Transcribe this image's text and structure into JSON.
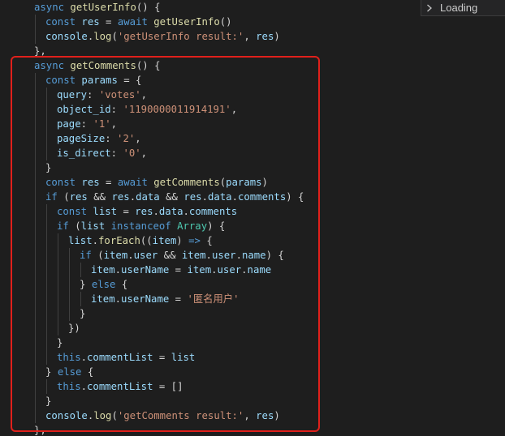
{
  "panel": {
    "label": "Loading",
    "icon": "chevron-right-icon"
  },
  "code_lines": [
    {
      "indent": 1,
      "tokens": [
        [
          "kw",
          "async "
        ],
        [
          "fn",
          "getUserInfo"
        ],
        [
          "pn",
          "() {"
        ]
      ]
    },
    {
      "indent": 2,
      "tokens": [
        [
          "kw",
          "const "
        ],
        [
          "vr",
          "res"
        ],
        [
          "pn",
          " = "
        ],
        [
          "kw",
          "await "
        ],
        [
          "fn",
          "getUserInfo"
        ],
        [
          "pn",
          "()"
        ]
      ]
    },
    {
      "indent": 2,
      "tokens": [
        [
          "vr",
          "console"
        ],
        [
          "pn",
          "."
        ],
        [
          "fn",
          "log"
        ],
        [
          "pn",
          "("
        ],
        [
          "st",
          "'getUserInfo result:'"
        ],
        [
          "pn",
          ", "
        ],
        [
          "vr",
          "res"
        ],
        [
          "pn",
          ")"
        ]
      ]
    },
    {
      "indent": 1,
      "tokens": [
        [
          "pn",
          "},"
        ]
      ]
    },
    {
      "indent": 1,
      "tokens": [
        [
          "kw",
          "async "
        ],
        [
          "fn",
          "getComments"
        ],
        [
          "pn",
          "() {"
        ]
      ]
    },
    {
      "indent": 2,
      "tokens": [
        [
          "kw",
          "const "
        ],
        [
          "vr",
          "params"
        ],
        [
          "pn",
          " = {"
        ]
      ]
    },
    {
      "indent": 3,
      "tokens": [
        [
          "vr",
          "query"
        ],
        [
          "pn",
          ": "
        ],
        [
          "st",
          "'votes'"
        ],
        [
          "pn",
          ","
        ]
      ]
    },
    {
      "indent": 3,
      "tokens": [
        [
          "vr",
          "object_id"
        ],
        [
          "pn",
          ": "
        ],
        [
          "st",
          "'1190000011914191'"
        ],
        [
          "pn",
          ","
        ]
      ]
    },
    {
      "indent": 3,
      "tokens": [
        [
          "vr",
          "page"
        ],
        [
          "pn",
          ": "
        ],
        [
          "st",
          "'1'"
        ],
        [
          "pn",
          ","
        ]
      ]
    },
    {
      "indent": 3,
      "tokens": [
        [
          "vr",
          "pageSize"
        ],
        [
          "pn",
          ": "
        ],
        [
          "st",
          "'2'"
        ],
        [
          "pn",
          ","
        ]
      ]
    },
    {
      "indent": 3,
      "tokens": [
        [
          "vr",
          "is_direct"
        ],
        [
          "pn",
          ": "
        ],
        [
          "st",
          "'0'"
        ],
        [
          "pn",
          ","
        ]
      ]
    },
    {
      "indent": 2,
      "tokens": [
        [
          "pn",
          "}"
        ]
      ]
    },
    {
      "indent": 2,
      "tokens": [
        [
          "kw",
          "const "
        ],
        [
          "vr",
          "res"
        ],
        [
          "pn",
          " = "
        ],
        [
          "kw",
          "await "
        ],
        [
          "fn",
          "getComments"
        ],
        [
          "pn",
          "("
        ],
        [
          "vr",
          "params"
        ],
        [
          "pn",
          ")"
        ]
      ]
    },
    {
      "indent": 2,
      "tokens": [
        [
          "kw",
          "if "
        ],
        [
          "pn",
          "("
        ],
        [
          "vr",
          "res"
        ],
        [
          "pn",
          " && "
        ],
        [
          "vr",
          "res"
        ],
        [
          "pn",
          "."
        ],
        [
          "vr",
          "data"
        ],
        [
          "pn",
          " && "
        ],
        [
          "vr",
          "res"
        ],
        [
          "pn",
          "."
        ],
        [
          "vr",
          "data"
        ],
        [
          "pn",
          "."
        ],
        [
          "vr",
          "comments"
        ],
        [
          "pn",
          ") {"
        ]
      ]
    },
    {
      "indent": 3,
      "tokens": [
        [
          "kw",
          "const "
        ],
        [
          "vr",
          "list"
        ],
        [
          "pn",
          " = "
        ],
        [
          "vr",
          "res"
        ],
        [
          "pn",
          "."
        ],
        [
          "vr",
          "data"
        ],
        [
          "pn",
          "."
        ],
        [
          "vr",
          "comments"
        ]
      ]
    },
    {
      "indent": 3,
      "tokens": [
        [
          "kw",
          "if "
        ],
        [
          "pn",
          "("
        ],
        [
          "vr",
          "list"
        ],
        [
          "pn",
          " "
        ],
        [
          "kw",
          "instanceof "
        ],
        [
          "ty",
          "Array"
        ],
        [
          "pn",
          ") {"
        ]
      ]
    },
    {
      "indent": 4,
      "tokens": [
        [
          "vr",
          "list"
        ],
        [
          "pn",
          "."
        ],
        [
          "fn",
          "forEach"
        ],
        [
          "pn",
          "(("
        ],
        [
          "vr",
          "item"
        ],
        [
          "pn",
          ") "
        ],
        [
          "kw",
          "=>"
        ],
        [
          "pn",
          " {"
        ]
      ]
    },
    {
      "indent": 5,
      "tokens": [
        [
          "kw",
          "if "
        ],
        [
          "pn",
          "("
        ],
        [
          "vr",
          "item"
        ],
        [
          "pn",
          "."
        ],
        [
          "vr",
          "user"
        ],
        [
          "pn",
          " && "
        ],
        [
          "vr",
          "item"
        ],
        [
          "pn",
          "."
        ],
        [
          "vr",
          "user"
        ],
        [
          "pn",
          "."
        ],
        [
          "vr",
          "name"
        ],
        [
          "pn",
          ") {"
        ]
      ]
    },
    {
      "indent": 6,
      "tokens": [
        [
          "vr",
          "item"
        ],
        [
          "pn",
          "."
        ],
        [
          "vr",
          "userName"
        ],
        [
          "pn",
          " = "
        ],
        [
          "vr",
          "item"
        ],
        [
          "pn",
          "."
        ],
        [
          "vr",
          "user"
        ],
        [
          "pn",
          "."
        ],
        [
          "vr",
          "name"
        ]
      ]
    },
    {
      "indent": 5,
      "tokens": [
        [
          "pn",
          "} "
        ],
        [
          "kw",
          "else"
        ],
        [
          "pn",
          " {"
        ]
      ]
    },
    {
      "indent": 6,
      "tokens": [
        [
          "vr",
          "item"
        ],
        [
          "pn",
          "."
        ],
        [
          "vr",
          "userName"
        ],
        [
          "pn",
          " = "
        ],
        [
          "st",
          "'匿名用户'"
        ]
      ]
    },
    {
      "indent": 5,
      "tokens": [
        [
          "pn",
          "}"
        ]
      ]
    },
    {
      "indent": 4,
      "tokens": [
        [
          "pn",
          "})"
        ]
      ]
    },
    {
      "indent": 3,
      "tokens": [
        [
          "pn",
          "}"
        ]
      ]
    },
    {
      "indent": 3,
      "tokens": [
        [
          "kw",
          "this"
        ],
        [
          "pn",
          "."
        ],
        [
          "vr",
          "commentList"
        ],
        [
          "pn",
          " = "
        ],
        [
          "vr",
          "list"
        ]
      ]
    },
    {
      "indent": 2,
      "tokens": [
        [
          "pn",
          "} "
        ],
        [
          "kw",
          "else"
        ],
        [
          "pn",
          " {"
        ]
      ]
    },
    {
      "indent": 3,
      "tokens": [
        [
          "kw",
          "this"
        ],
        [
          "pn",
          "."
        ],
        [
          "vr",
          "commentList"
        ],
        [
          "pn",
          " = []"
        ]
      ]
    },
    {
      "indent": 2,
      "tokens": [
        [
          "pn",
          "}"
        ]
      ]
    },
    {
      "indent": 2,
      "tokens": [
        [
          "vr",
          "console"
        ],
        [
          "pn",
          "."
        ],
        [
          "fn",
          "log"
        ],
        [
          "pn",
          "("
        ],
        [
          "st",
          "'getComments result:'"
        ],
        [
          "pn",
          ", "
        ],
        [
          "vr",
          "res"
        ],
        [
          "pn",
          ")"
        ]
      ]
    },
    {
      "indent": 1,
      "tokens": [
        [
          "pn",
          "},"
        ]
      ]
    }
  ],
  "colors": {
    "background": "#1e1e1e",
    "keyword": "#569cd6",
    "function": "#dcdcaa",
    "variable": "#9cdcfe",
    "type": "#4ec9b0",
    "string": "#ce9178",
    "punctuation": "#d4d4d4",
    "highlight_box": "#e0201b"
  }
}
